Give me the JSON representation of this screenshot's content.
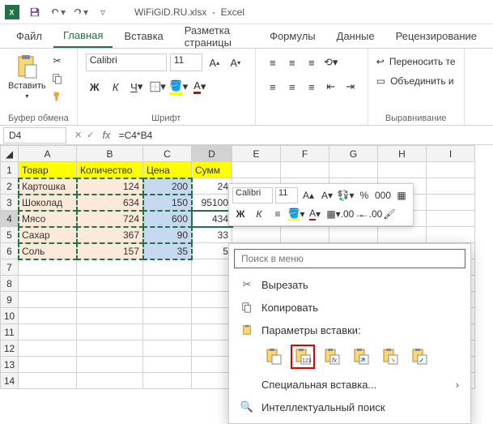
{
  "app": {
    "title_doc": "WiFiGiD.RU.xlsx",
    "title_app": "Excel"
  },
  "tabs": [
    "Файл",
    "Главная",
    "Вставка",
    "Разметка страницы",
    "Формулы",
    "Данные",
    "Рецензирование"
  ],
  "active_tab": 1,
  "ribbon": {
    "clipboard": {
      "paste": "Вставить",
      "group": "Буфер обмена"
    },
    "font": {
      "name": "Calibri",
      "size": "11",
      "group": "Шрифт"
    },
    "align": {
      "wrap": "Переносить те",
      "merge": "Объединить и",
      "group": "Выравнивание"
    }
  },
  "namebox": "D4",
  "formula": "=C4*B4",
  "columns": [
    "A",
    "B",
    "C",
    "D",
    "E",
    "F",
    "G",
    "H",
    "I"
  ],
  "rows": [
    1,
    2,
    3,
    4,
    5,
    6,
    7,
    8,
    9,
    10,
    11,
    12,
    13,
    14
  ],
  "headers": [
    "Товар",
    "Количество",
    "Цена",
    "Сумм"
  ],
  "data_rows": [
    {
      "name": "Картошка",
      "qty": "124",
      "price": "200",
      "sum": "24"
    },
    {
      "name": "Шоколад",
      "qty": "634",
      "price": "150",
      "sum": "95100"
    },
    {
      "name": "Мясо",
      "qty": "724",
      "price": "600",
      "sum": "434"
    },
    {
      "name": "Сахар",
      "qty": "367",
      "price": "90",
      "sum": "33"
    },
    {
      "name": "Соль",
      "qty": "157",
      "price": "35",
      "sum": "5"
    }
  ],
  "active_row": 4,
  "mini_toolbar": {
    "font": "Calibri",
    "size": "11"
  },
  "context_menu": {
    "search_placeholder": "Поиск в меню",
    "cut": "Вырезать",
    "copy": "Копировать",
    "paste_hdr": "Параметры вставки:",
    "special": "Специальная вставка...",
    "smart": "Интеллектуальный поиск"
  }
}
